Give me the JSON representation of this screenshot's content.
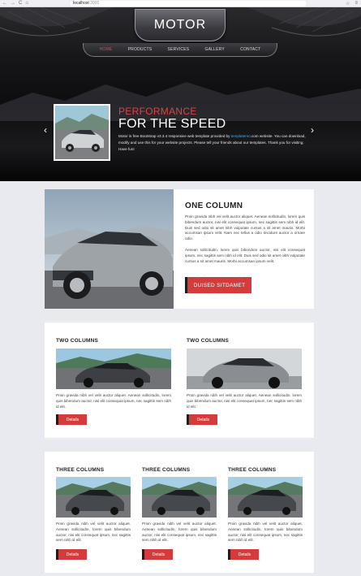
{
  "browser": {
    "back": "←",
    "forward": "→",
    "reload": "C",
    "home": "⌂",
    "url": "localhost",
    "port": ":3000",
    "bookmark_icon": "☆",
    "menu_icon": "≡"
  },
  "header": {
    "logo": "MOTOR",
    "nav": [
      {
        "label": "HOME",
        "active": true
      },
      {
        "label": "PRODUCTS",
        "active": false
      },
      {
        "label": "SERVICES",
        "active": false
      },
      {
        "label": "GALLERY",
        "active": false
      },
      {
        "label": "CONTACT",
        "active": false
      }
    ]
  },
  "slider": {
    "title_line1": "PERFORMANCE",
    "title_line2": "FOR THE SPEED",
    "text_before_link": "Motor is free Bootstrap v3.3.4 responsive web template provided by ",
    "link": "templatemo",
    "text_after_link": ".com website. You can download, modify and use this for your website projects. Please tell your friends about our templates. Thank you for visiting. Have fun!",
    "prev_icon": "‹",
    "next_icon": "›"
  },
  "one_column": {
    "title": "ONE COLUMN",
    "p1": "Proin gravida nibh vel velit auctor aliquet. Aenean sollicitudin, lorem quis bibendum auctor, nisi elit consequat ipsum, nec sagittis sem nibh id elit. Duis sed odio sit amet nibh vulputate cursus a sit amet mauris. Morbi accumsan ipsum velit. Nam nec tellus a odio tincidunt auctor a ornare odio.",
    "p2": "Aenean sollicitudin, lorem quis bibendum auctor, nisi elit consequat ipsum, nec sagittis sem nibh id elit. Duis sed odio sit amet nibh vulputate cursus a sit amet mauris. Morbi accumsan ipsum velit.",
    "button": "DUISED SITDAMET"
  },
  "two_columns": [
    {
      "title": "TWO COLUMNS",
      "text": "Proin gravida nibh vel velit auctor aliquet. Aenean sollicitudin, lorem quis bibendum auctor, nisi elit consequat ipsum, nec sagittis sem nibh id elit.",
      "button": "Details"
    },
    {
      "title": "TWO COLUMNS",
      "text": "Proin gravida nibh vel velit auctor aliquet. Aenean sollicitudin, lorem quis bibendum auctor, nisi elit consequat ipsum, nec sagittis sem nibh id elit.",
      "button": "Details"
    }
  ],
  "three_columns": [
    {
      "title": "THREE COLUMNS",
      "text": "Proin gravida nibh vel velit auctor aliquet. Aenean sollicitudin, lorem quis bibendum auctor, nisi elit consequat ipsum, nec sagittis sem nibh id elit.",
      "button": "Details"
    },
    {
      "title": "THREE COLUMNS",
      "text": "Proin gravida nibh vel velit auctor aliquet. Aenean sollicitudin, lorem quis bibendum auctor, nisi elit consequat ipsum, nec sagittis sem nibh id elit.",
      "button": "Details"
    },
    {
      "title": "THREE COLUMNS",
      "text": "Proin gravida nibh vel velit auctor aliquet. Aenean sollicitudin, lorem quis bibendum auctor, nisi elit consequat ipsum, nec sagittis sem nibh id elit.",
      "button": "Details"
    }
  ],
  "colors": {
    "accent": "#d43c3c",
    "nav_active": "#e04848",
    "page_bg": "#e9e9f0",
    "link": "#4aa8e8"
  }
}
